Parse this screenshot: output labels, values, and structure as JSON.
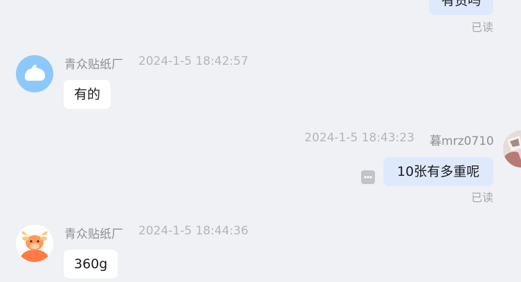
{
  "messages": [
    {
      "direction": "outgoing",
      "text": "有货吗",
      "status": "已读"
    },
    {
      "direction": "incoming",
      "sender": "青众贴纸厂",
      "time": "2024-1-5 18:42:57",
      "text": "有的",
      "avatar_icon": "cloud-avatar-icon"
    },
    {
      "direction": "outgoing",
      "sender": "暮mrz0710",
      "time": "2024-1-5 18:43:23",
      "text": "10张有多重呢",
      "status": "已读",
      "more_icon": "more-options-icon"
    },
    {
      "direction": "incoming",
      "sender": "青众贴纸厂",
      "time": "2024-1-5 18:44:36",
      "text": "360g",
      "avatar_icon": "ox-avatar-icon"
    }
  ],
  "colors": {
    "background": "#f0f1f5",
    "incoming_bubble": "#ffffff",
    "outgoing_bubble": "#dfe9fd",
    "cloud_avatar": "#8dc8fb",
    "ox_avatar": "#ff7a45"
  }
}
